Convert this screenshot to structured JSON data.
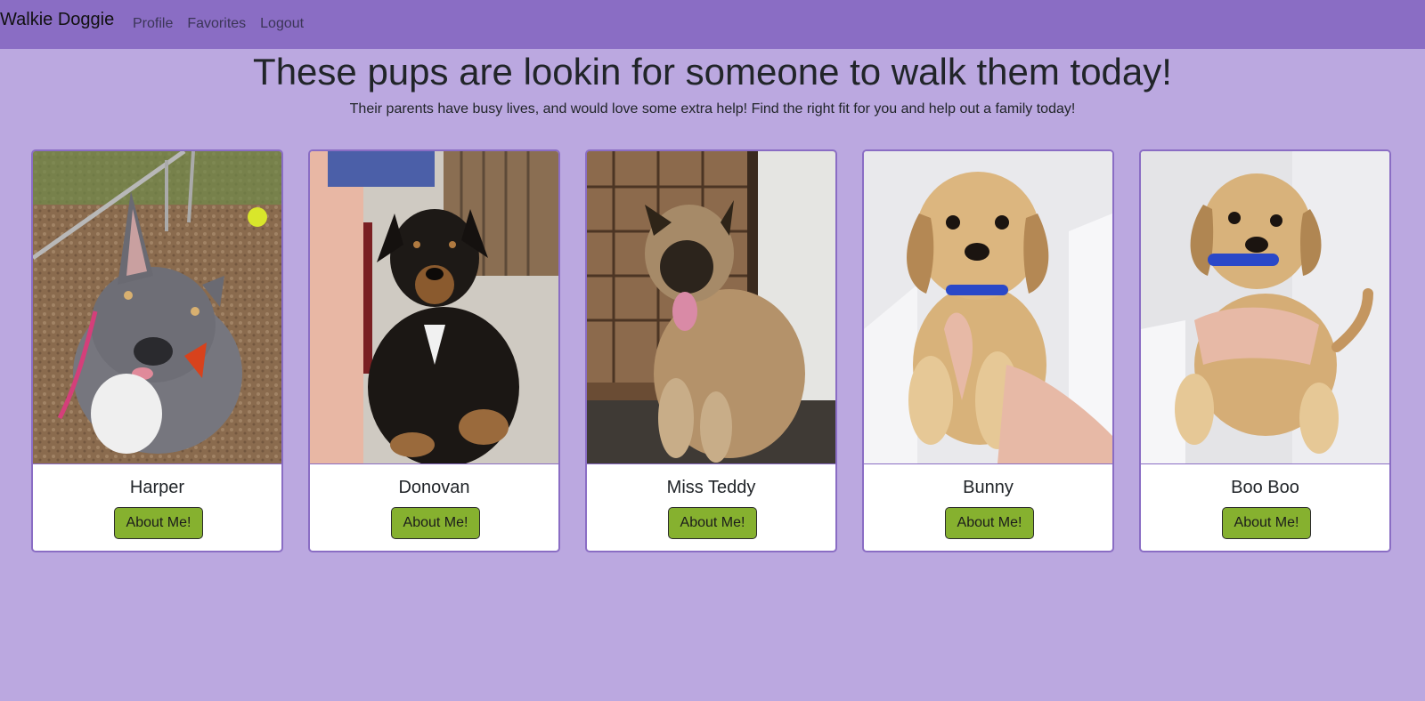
{
  "nav": {
    "brand": "Walkie Doggie",
    "links": [
      "Profile",
      "Favorites",
      "Logout"
    ]
  },
  "hero": {
    "title": "These pups are lookin for someone to walk them today!",
    "subtitle": "Their parents have busy lives, and would love some extra help! Find the right fit for you and help out a family today!"
  },
  "dogs": [
    {
      "name": "Harper",
      "button_label": "About Me!",
      "photo_icon": "gray-pitbull-photo"
    },
    {
      "name": "Donovan",
      "button_label": "About Me!",
      "photo_icon": "black-tan-dog-photo"
    },
    {
      "name": "Miss Teddy",
      "button_label": "About Me!",
      "photo_icon": "fluffy-tan-dog-photo"
    },
    {
      "name": "Bunny",
      "button_label": "About Me!",
      "photo_icon": "yellow-puppy-photo"
    },
    {
      "name": "Boo Boo",
      "button_label": "About Me!",
      "photo_icon": "yellow-puppy-photo"
    }
  ],
  "colors": {
    "background": "#bba8e0",
    "navbar": "#8a6dc4",
    "button": "#86b12f",
    "card_border": "#8a6dc4"
  }
}
